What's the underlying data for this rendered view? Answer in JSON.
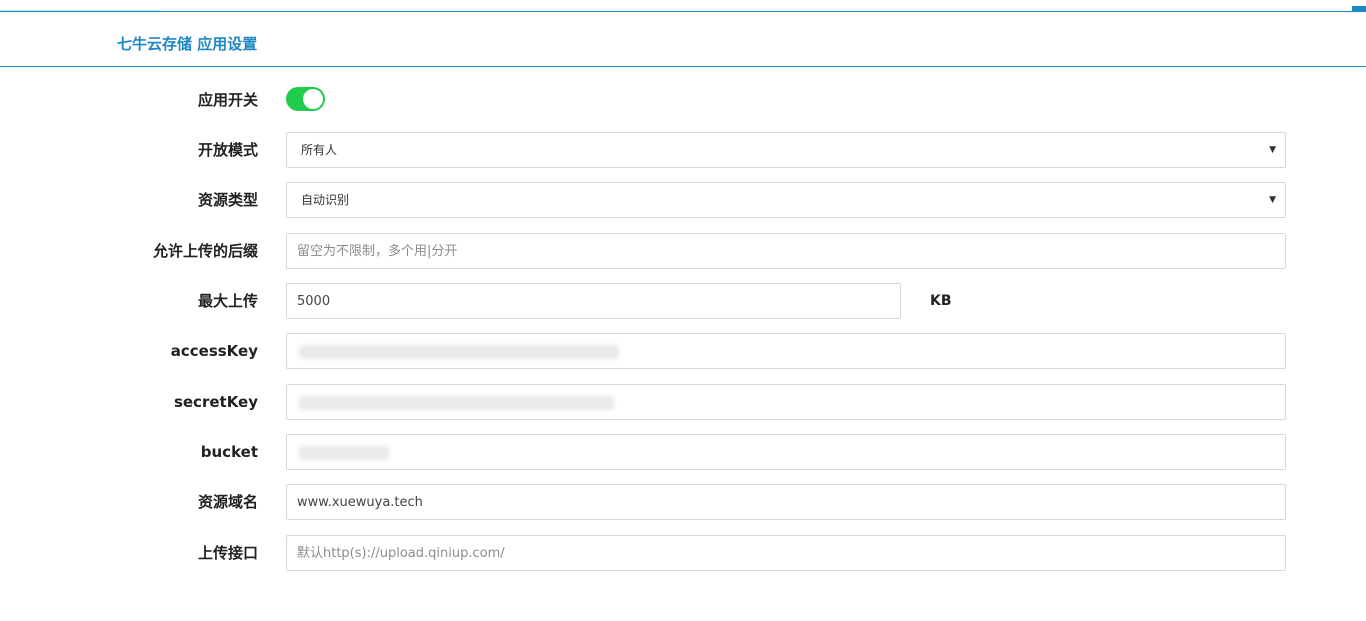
{
  "header": {
    "title": "七牛云存储 应用设置"
  },
  "form": {
    "toggle": {
      "label": "应用开关",
      "on": true
    },
    "open_mode": {
      "label": "开放模式",
      "value": "所有人"
    },
    "resource_type": {
      "label": "资源类型",
      "value": "自动识别"
    },
    "allowed_suffix": {
      "label": "允许上传的后缀",
      "value": "",
      "placeholder": "留空为不限制，多个用|分开"
    },
    "max_upload": {
      "label": "最大上传",
      "value": "5000",
      "unit": "KB"
    },
    "access_key": {
      "label": "accessKey",
      "value": ""
    },
    "secret_key": {
      "label": "secretKey",
      "value": ""
    },
    "bucket": {
      "label": "bucket",
      "value": ""
    },
    "resource_domain": {
      "label": "资源域名",
      "value": "www.xuewuya.tech"
    },
    "upload_api": {
      "label": "上传接口",
      "value": "",
      "placeholder": "默认http(s)://upload.qiniup.com/"
    }
  },
  "icons": {
    "select_arrow": "caret-down-icon"
  },
  "colors": {
    "accent": "#1e88c7",
    "switch_on": "#1fcc4b",
    "border": "#d8d8d8"
  }
}
